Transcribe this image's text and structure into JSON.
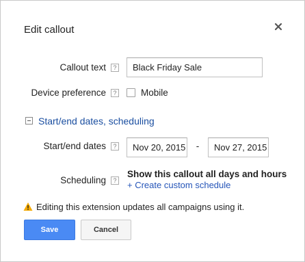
{
  "dialog": {
    "title": "Edit callout",
    "close_icon": "close-icon"
  },
  "callout_text": {
    "label": "Callout text",
    "help": "?",
    "value": "Black Friday Sale"
  },
  "device_preference": {
    "label": "Device preference",
    "help": "?",
    "option_label": "Mobile",
    "checked": false
  },
  "scheduling_section": {
    "toggle_icon": "collapse-icon",
    "label": "Start/end dates, scheduling"
  },
  "dates": {
    "label": "Start/end dates",
    "help": "?",
    "start": "Nov 20, 2015",
    "separator": "-",
    "end": "Nov 27, 2015"
  },
  "scheduling": {
    "label": "Scheduling",
    "help": "?",
    "summary": "Show this callout all days and hours",
    "custom_link": "+ Create custom schedule"
  },
  "warning": {
    "icon": "warning-icon",
    "text": "Editing this extension updates all campaigns using it.",
    "color": "#f4a900"
  },
  "buttons": {
    "save": "Save",
    "cancel": "Cancel",
    "save_color": "#4a8af4"
  }
}
